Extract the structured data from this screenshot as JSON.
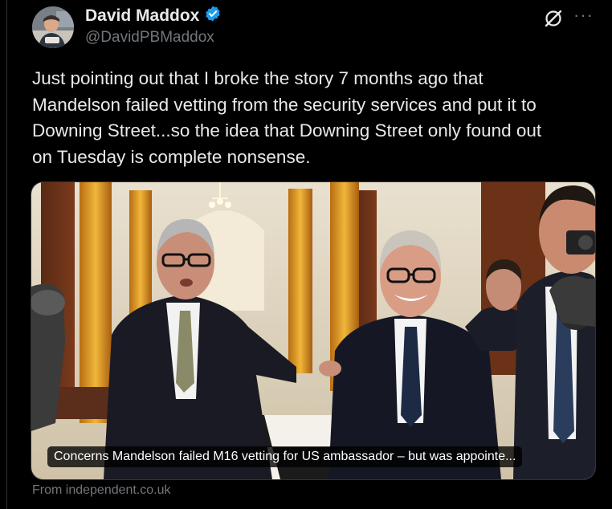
{
  "author": {
    "name": "David Maddox",
    "handle": "@DavidPBMaddox",
    "verified": true,
    "verified_color": "#1d9bf0"
  },
  "tweet": {
    "text_lines": [
      "Just pointing out that I broke the story 7 months ago that",
      "Mandelson failed vetting from the security services and put it to",
      "Downing Street...so the idea that Downing Street only found out",
      "on Tuesday is complete nonsense."
    ]
  },
  "actions": {
    "grok_icon": "grok-icon",
    "more_icon": "more-icon",
    "more_label": "···"
  },
  "card": {
    "caption": "Concerns Mandelson failed M16 vetting for US ambassador – but was appointe...",
    "source": "From independent.co.uk"
  },
  "colors": {
    "background": "#000000",
    "text": "#e7e9ea",
    "secondary": "#71767b",
    "accent": "#1d9bf0"
  }
}
